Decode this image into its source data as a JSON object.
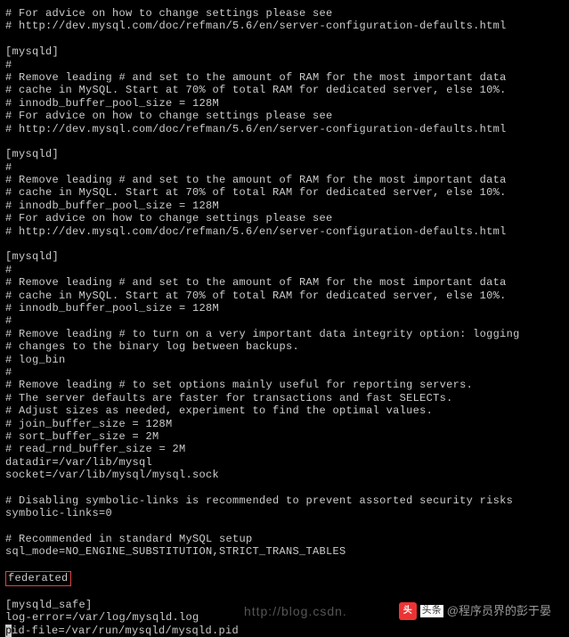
{
  "lines": [
    "# For advice on how to change settings please see",
    "# http://dev.mysql.com/doc/refman/5.6/en/server-configuration-defaults.html",
    "",
    "[mysqld]",
    "#",
    "# Remove leading # and set to the amount of RAM for the most important data",
    "# cache in MySQL. Start at 70% of total RAM for dedicated server, else 10%.",
    "# innodb_buffer_pool_size = 128M",
    "# For advice on how to change settings please see",
    "# http://dev.mysql.com/doc/refman/5.6/en/server-configuration-defaults.html",
    "",
    "[mysqld]",
    "#",
    "# Remove leading # and set to the amount of RAM for the most important data",
    "# cache in MySQL. Start at 70% of total RAM for dedicated server, else 10%.",
    "# innodb_buffer_pool_size = 128M",
    "# For advice on how to change settings please see",
    "# http://dev.mysql.com/doc/refman/5.6/en/server-configuration-defaults.html",
    "",
    "[mysqld]",
    "#",
    "# Remove leading # and set to the amount of RAM for the most important data",
    "# cache in MySQL. Start at 70% of total RAM for dedicated server, else 10%.",
    "# innodb_buffer_pool_size = 128M",
    "#",
    "# Remove leading # to turn on a very important data integrity option: logging",
    "# changes to the binary log between backups.",
    "# log_bin",
    "#",
    "# Remove leading # to set options mainly useful for reporting servers.",
    "# The server defaults are faster for transactions and fast SELECTs.",
    "# Adjust sizes as needed, experiment to find the optimal values.",
    "# join_buffer_size = 128M",
    "# sort_buffer_size = 2M",
    "# read_rnd_buffer_size = 2M",
    "datadir=/var/lib/mysql",
    "socket=/var/lib/mysql/mysql.sock",
    "",
    "# Disabling symbolic-links is recommended to prevent assorted security risks",
    "symbolic-links=0",
    "",
    "# Recommended in standard MySQL setup",
    "sql_mode=NO_ENGINE_SUBSTITUTION,STRICT_TRANS_TABLES",
    ""
  ],
  "highlighted": "federated",
  "section_safe": "[mysqld_safe]",
  "log_error": "log-error=/var/log/mysqld.log",
  "pid_file_prefix": "p",
  "pid_file_rest": "id-file=/var/run/mysqld/mysqld.pid",
  "watermark": {
    "url": "http://blog.csdn.",
    "brand": "头条",
    "at": "@程序员界的彭于晏"
  }
}
